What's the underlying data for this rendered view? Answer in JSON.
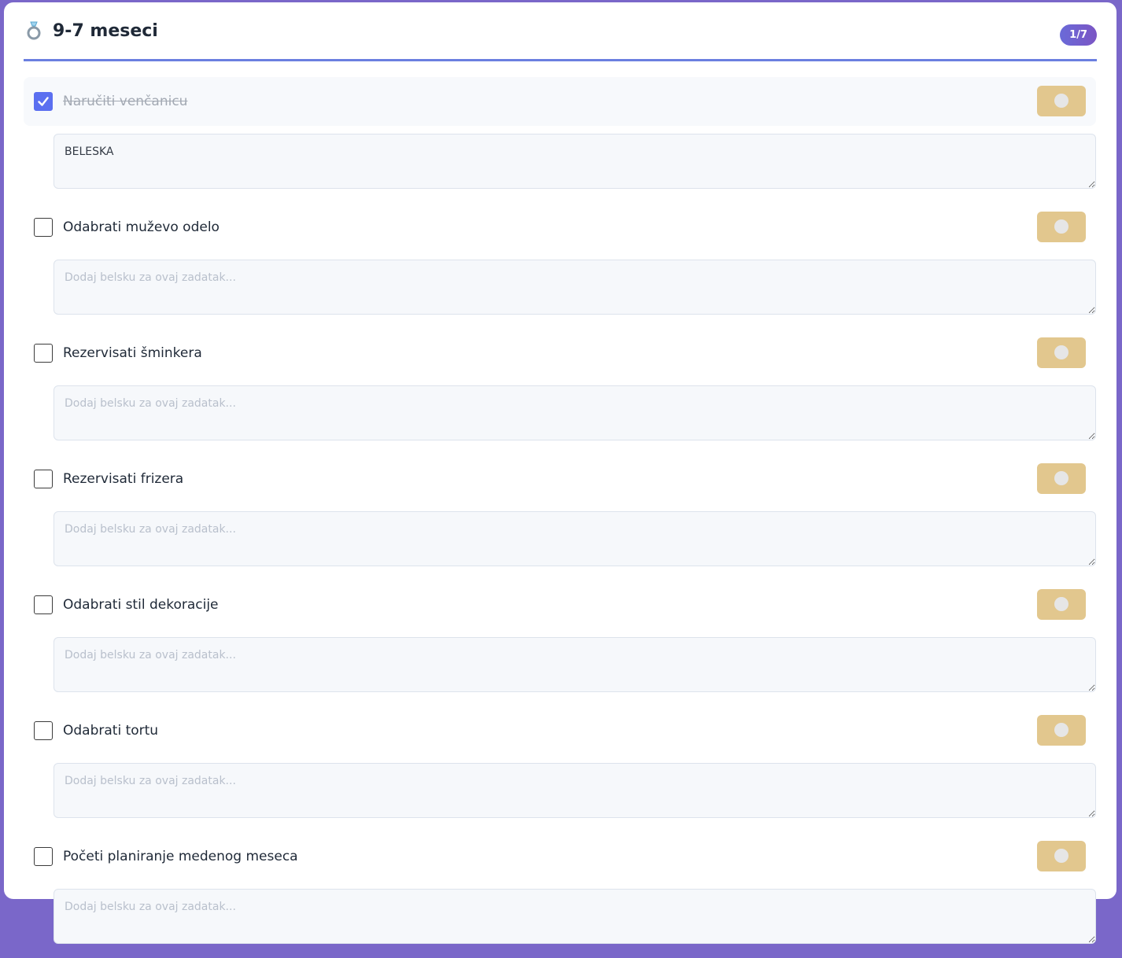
{
  "section": {
    "title": "9-7 meseci",
    "icon": "ring-icon",
    "progress_badge": "1/7"
  },
  "tasks": [
    {
      "label": "Naručiti venčanicu",
      "checked": true,
      "note_value": "BELESKA",
      "note_placeholder": "Dodaj belsku za ovaj zadatak..."
    },
    {
      "label": "Odabrati muževo odelo",
      "checked": false,
      "note_value": "",
      "note_placeholder": "Dodaj belsku za ovaj zadatak..."
    },
    {
      "label": "Rezervisati šminkera",
      "checked": false,
      "note_value": "",
      "note_placeholder": "Dodaj belsku za ovaj zadatak..."
    },
    {
      "label": "Rezervisati frizera",
      "checked": false,
      "note_value": "",
      "note_placeholder": "Dodaj belsku za ovaj zadatak..."
    },
    {
      "label": "Odabrati stil dekoracije",
      "checked": false,
      "note_value": "",
      "note_placeholder": "Dodaj belsku za ovaj zadatak..."
    },
    {
      "label": "Odabrati tortu",
      "checked": false,
      "note_value": "",
      "note_placeholder": "Dodaj belsku za ovaj zadatak..."
    },
    {
      "label": "Početi planiranje medenog meseca",
      "checked": false,
      "note_value": "",
      "note_placeholder": "Dodaj belsku za ovaj zadatak..."
    }
  ],
  "colors": {
    "accent": "#5b6ff0",
    "toggle": "#e2c78e",
    "border_frame": "#7a67c9"
  }
}
